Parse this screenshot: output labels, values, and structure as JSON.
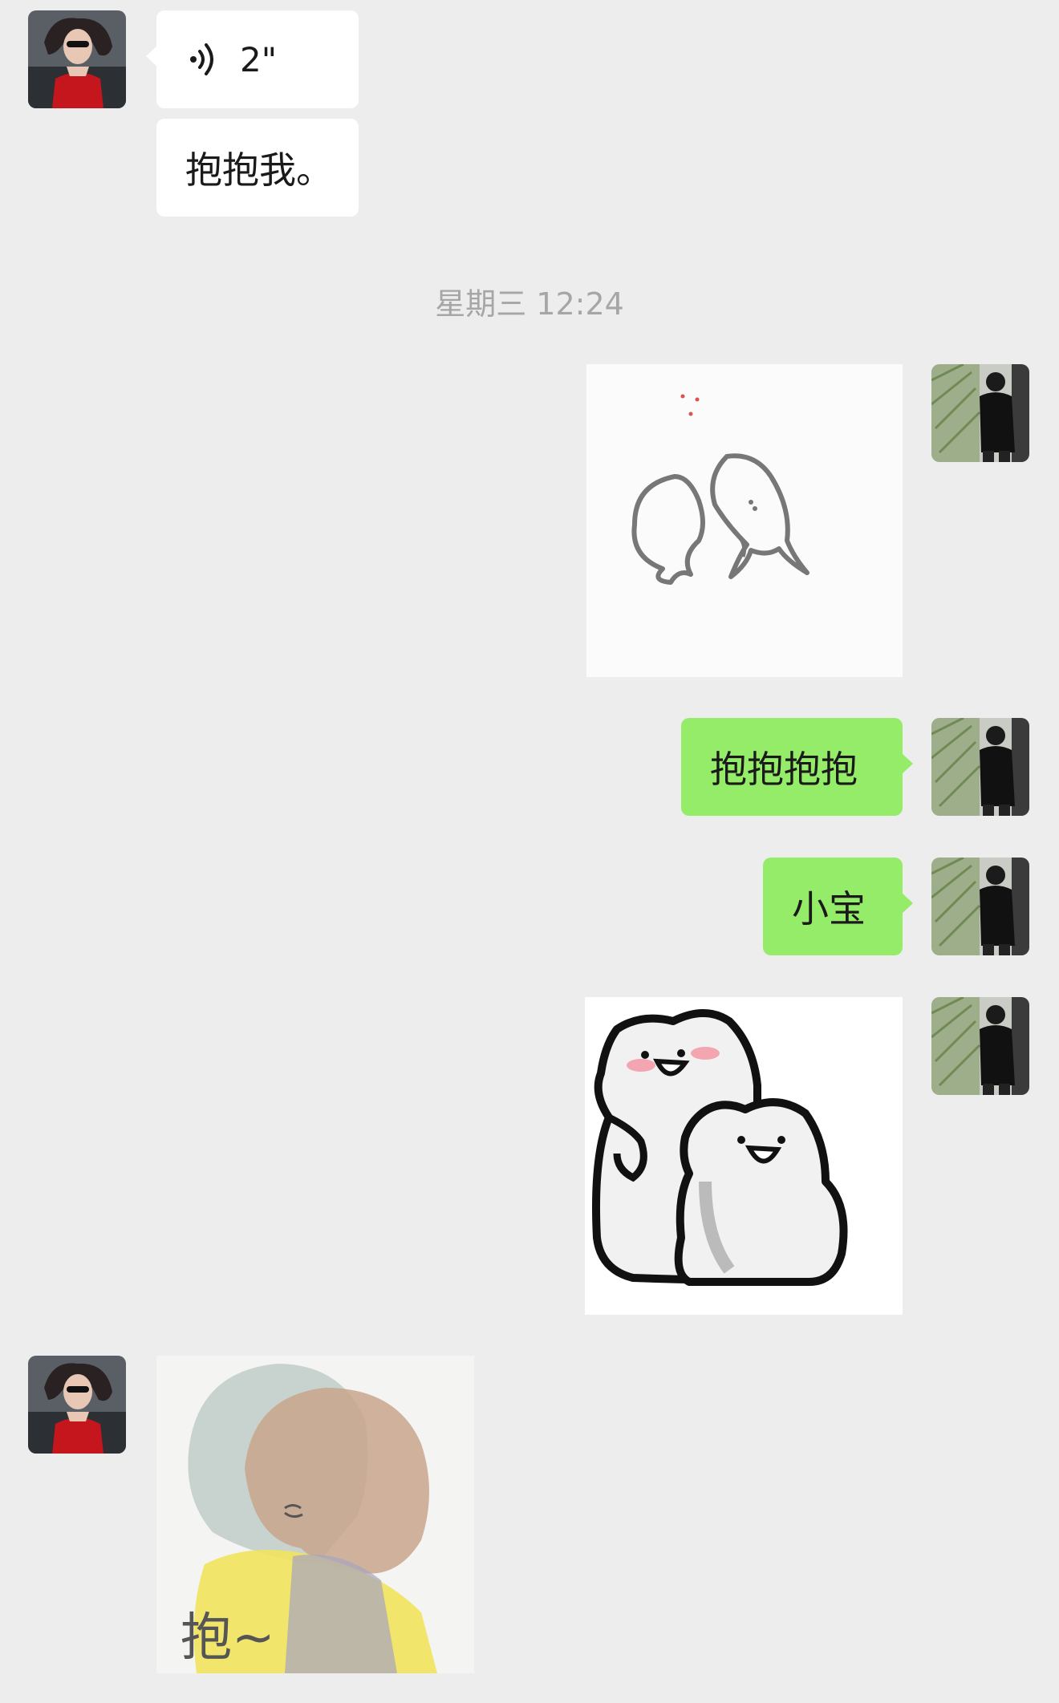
{
  "messages": [
    {
      "sender": "other",
      "type": "voice",
      "duration": "2\"",
      "icon": "voice-wave-icon"
    },
    {
      "sender": "other",
      "type": "text",
      "text": "抱抱我。"
    },
    {
      "sender": "self",
      "type": "sticker",
      "sticker": "hugging-blob-drawing"
    },
    {
      "sender": "self",
      "type": "text",
      "text": "抱抱抱抱"
    },
    {
      "sender": "self",
      "type": "text",
      "text": "小宝"
    },
    {
      "sender": "self",
      "type": "sticker",
      "sticker": "two-white-cats-hugging"
    },
    {
      "sender": "other",
      "type": "sticker",
      "sticker": "anime-couple-hug",
      "caption": "抱~"
    }
  ],
  "timestamp": "星期三 12:24",
  "colors": {
    "background": "#ededed",
    "self_bubble": "#95ec69",
    "other_bubble": "#ffffff",
    "timestamp_text": "#a6a6a6"
  }
}
